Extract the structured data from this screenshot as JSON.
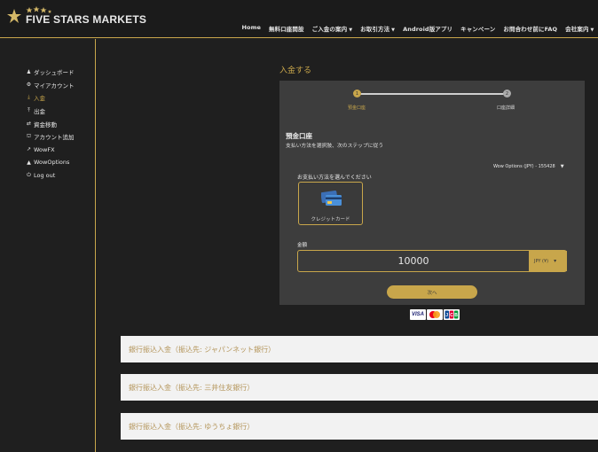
{
  "header": {
    "logo_text": "FIVE STARS MARKETS",
    "nav": [
      {
        "label": "Home",
        "dropdown": false
      },
      {
        "label": "無料口座開設",
        "dropdown": false
      },
      {
        "label": "ご入金の案内",
        "dropdown": true
      },
      {
        "label": "お取引方法",
        "dropdown": true
      },
      {
        "label": "Android版アプリ",
        "dropdown": false
      },
      {
        "label": "キャンペーン",
        "dropdown": false
      },
      {
        "label": "お問合わせ前にFAQ",
        "dropdown": false
      },
      {
        "label": "会社案内",
        "dropdown": true
      }
    ]
  },
  "sidebar": {
    "items": [
      {
        "label": "ダッシュボード",
        "icon": "user-icon",
        "active": false
      },
      {
        "label": "マイアカウント",
        "icon": "gear-icon",
        "active": false
      },
      {
        "label": "入金",
        "icon": "download-icon",
        "active": true
      },
      {
        "label": "出金",
        "icon": "upload-icon",
        "active": false
      },
      {
        "label": "資金移動",
        "icon": "transfer-icon",
        "active": false
      },
      {
        "label": "アカウント追加",
        "icon": "bank-icon",
        "active": false
      },
      {
        "label": "WowFX",
        "icon": "chart-icon",
        "active": false
      },
      {
        "label": "WowOptions",
        "icon": "area-chart-icon",
        "active": false
      },
      {
        "label": "Log out",
        "icon": "power-icon",
        "active": false
      }
    ]
  },
  "main": {
    "title": "入金する",
    "steps": [
      {
        "num": "1",
        "label": "預金口座"
      },
      {
        "num": "2",
        "label": "口座詳細"
      }
    ],
    "section_title": "預金口座",
    "section_subtitle": "支払い方法を選択肢、次のステップに従う",
    "account_select": "Wow Options (JPY) - 155428",
    "choose_label": "お支払い方法を選んでください",
    "payment_method": "クレジットカード",
    "amount_label": "金額",
    "amount_value": "10000",
    "currency": "JPY (¥)",
    "next_label": "次へ",
    "card_brands": [
      "VISA",
      "MasterCard",
      "JCB"
    ]
  },
  "bank_transfers": [
    "銀行振込入金（振込先: ジャパンネット銀行）",
    "銀行振込入金（振込先: 三井住友銀行）",
    "銀行振込入金（振込先: ゆうちょ銀行）"
  ],
  "colors": {
    "accent": "#c8a64b",
    "background": "#1f1f1f",
    "panel": "#3d3d3d"
  }
}
